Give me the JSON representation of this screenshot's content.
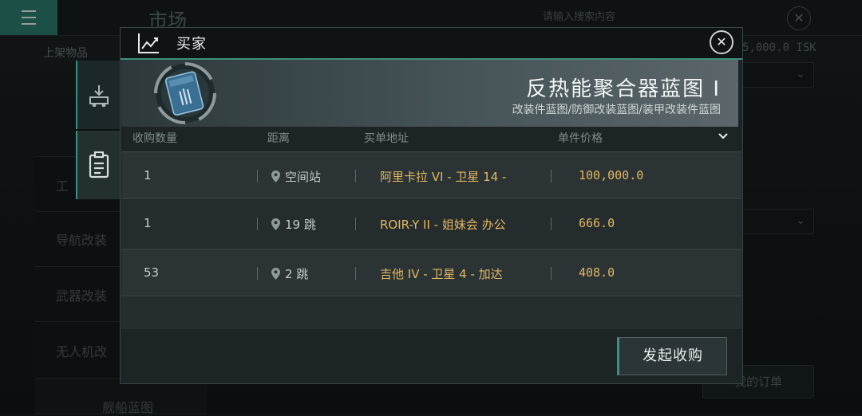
{
  "background": {
    "menu_icon": "hamburger-icon",
    "title": "市场",
    "search_placeholder": "请输入搜索内容",
    "sidebar_header": "上架物品",
    "isk_balance": "5,000.0 ISK",
    "side_items": [
      "工",
      "导航改装",
      "武器改装",
      "无人机改"
    ],
    "bottom_item": "舰船蓝图",
    "bottom_button": "我的订单"
  },
  "dialog": {
    "title": "买家",
    "header_icon": "chart-line-icon",
    "close_icon": "close-icon",
    "side_tabs": [
      {
        "icon": "inbox-download-icon"
      },
      {
        "icon": "clipboard-icon"
      }
    ],
    "item": {
      "name": "反热能聚合器蓝图 I",
      "category": "改装件蓝图/防御改装蓝图/装甲改装件蓝图"
    },
    "columns": {
      "quantity": "收购数量",
      "distance": "距离",
      "address": "买单地址",
      "price": "单件价格"
    },
    "sort_icon": "chevron-down-icon",
    "orders": [
      {
        "quantity": "1",
        "distance": "空间站",
        "address": "阿里卡拉 VI - 卫星 14 -",
        "price": "100,000.0"
      },
      {
        "quantity": "1",
        "distance": "19 跳",
        "address": "ROIR-Y II - 姐妹会 办公",
        "price": "666.0"
      },
      {
        "quantity": "53",
        "distance": "2 跳",
        "address": "吉他 IV - 卫星 4 - 加达",
        "price": "408.0"
      }
    ],
    "action_button": "发起收购"
  },
  "colors": {
    "accent": "#3e8f7d",
    "price": "#e2b860"
  }
}
